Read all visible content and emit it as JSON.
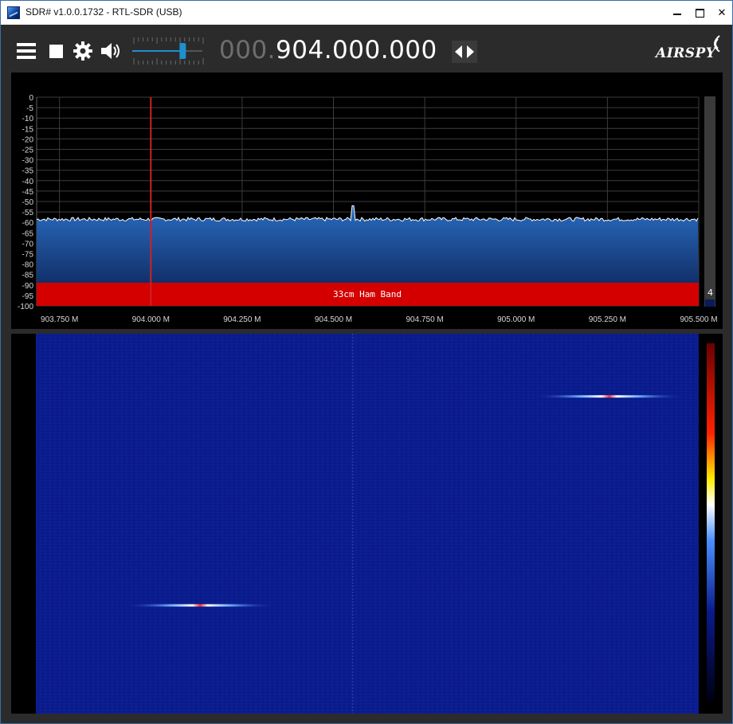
{
  "window": {
    "title": "SDR# v1.0.0.1732 - RTL-SDR (USB)",
    "minimize": "minimize",
    "maximize": "maximize",
    "close": "✕"
  },
  "toolbar": {
    "menu_icon": "hamburger-menu-icon",
    "stop_icon": "stop-icon",
    "settings_icon": "gear-icon",
    "audio_icon": "speaker-icon",
    "volume_level": 0.72,
    "frequency_prefix": "000.",
    "frequency_main": "904.000.000",
    "tune_icon": "left-right-arrows-icon",
    "brand": "AIRSPY"
  },
  "colors": {
    "background": "#2b2b2b",
    "spectrum_fill": "#1e5aa8",
    "band_red": "#d40000",
    "center_line": "#cc2222",
    "waterfall_bg": "#0a1a8c",
    "accent": "#1e90d0"
  },
  "spectrum": {
    "y_axis_labels": [
      "0",
      "-5",
      "-10",
      "-15",
      "-20",
      "-25",
      "-30",
      "-35",
      "-40",
      "-45",
      "-50",
      "-55",
      "-60",
      "-65",
      "-70",
      "-75",
      "-80",
      "-85",
      "-90",
      "-95",
      "-100"
    ],
    "x_axis_labels": [
      "903.750 M",
      "904.000 M",
      "904.250 M",
      "904.500 M",
      "904.750 M",
      "905.000 M",
      "905.250 M",
      "905.500 M"
    ],
    "band_label": "33cm Ham Band",
    "zoom_value": "4",
    "tuned_frequency_mhz": 904.0,
    "noise_floor_db": -58.5,
    "peak": {
      "freq_mhz": 904.553,
      "db": -52
    }
  },
  "waterfall": {
    "signals": [
      {
        "freq_mhz": 905.255,
        "row_fraction": 0.165
      },
      {
        "freq_mhz": 904.135,
        "row_fraction": 0.715
      }
    ],
    "center_stripe_mhz": 904.553
  }
}
